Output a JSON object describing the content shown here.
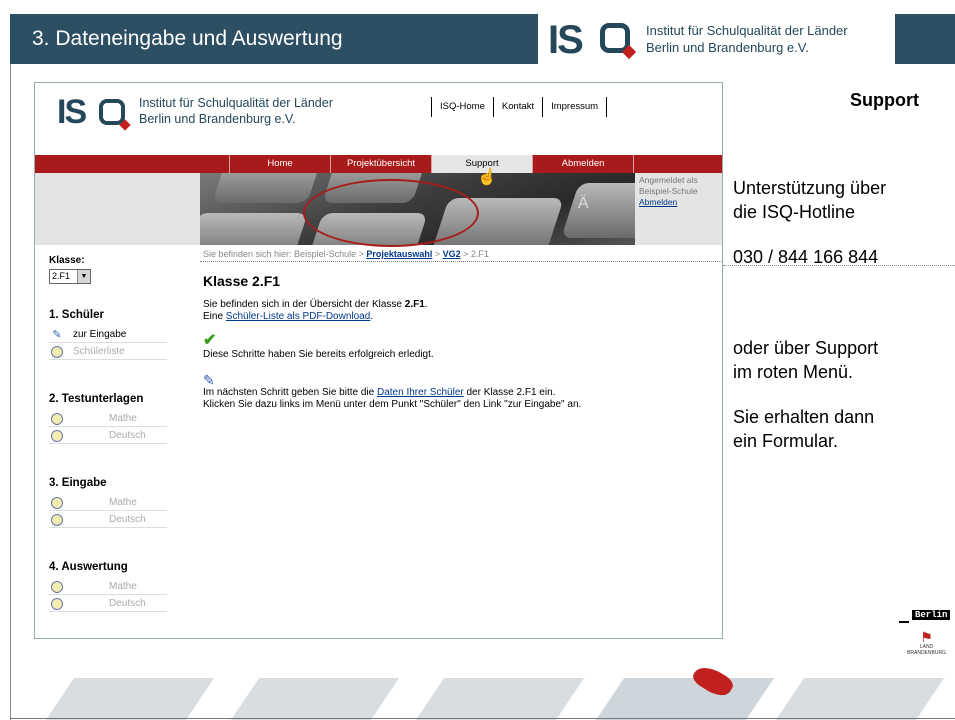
{
  "slide": {
    "title": "3.  Dateneingabe und Auswertung",
    "logo_text_line1": "Institut für Schulqualität der Länder",
    "logo_text_line2": "Berlin und Brandenburg e.V.",
    "logo_letters": "IS"
  },
  "web": {
    "logo_text_line1": "Institut für Schulqualität der Länder",
    "logo_text_line2": "Berlin und Brandenburg e.V.",
    "top_links": [
      "ISQ-Home",
      "Kontakt",
      "Impressum"
    ],
    "nav": [
      "Home",
      "Projektübersicht",
      "Support",
      "Abmelden"
    ],
    "nav_active": "Support",
    "banner_keys": [
      "Ä"
    ],
    "login": {
      "line1": "Angemeldet als",
      "line2": "Beispiel-Schule",
      "logout": "Abmelden"
    },
    "breadcrumb": {
      "prefix": "Sie befinden sich hier: Beispiel-Schule > ",
      "link1": "Projektauswahl",
      "sep": " > ",
      "link2": "VG2",
      "suffix": " > 2.F1"
    },
    "sidebar": {
      "klasse_label": "Klasse:",
      "klasse_value": "2.F1",
      "sections": [
        {
          "title": "1. Schüler",
          "items": [
            "zur Eingabe",
            "Schülerliste"
          ]
        },
        {
          "title": "2. Testunterlagen",
          "items": [
            "Mathe",
            "Deutsch"
          ]
        },
        {
          "title": "3. Eingabe",
          "items": [
            "Mathe",
            "Deutsch"
          ]
        },
        {
          "title": "4. Auswertung",
          "items": [
            "Mathe",
            "Deutsch"
          ]
        }
      ]
    },
    "main": {
      "heading": "Klasse 2.F1",
      "intro_1": "Sie befinden sich in der Übersicht der Klasse ",
      "intro_bold": "2.F1",
      "intro_2": ".",
      "intro_line2_prefix": "Eine ",
      "pdf_link": "Schüler-Liste als PDF-Download",
      "intro_line2_suffix": ".",
      "done_text": "Diese Schritte haben Sie bereits erfolgreich erledigt.",
      "next_1": "Im nächsten Schritt geben Sie bitte die ",
      "next_link": "Daten Ihrer Schüler",
      "next_2": " der Klasse 2.F1 ein.",
      "next_line2": "Klicken Sie dazu links im Menü unter dem Punkt \"Schüler\" den Link \"zur Eingabe\" an."
    }
  },
  "right": {
    "heading": "Support",
    "p1_line1": "Unterstützung über",
    "p1_line2": "die ISQ-Hotline",
    "phone": "030 / 844 166 844",
    "p2_line1": "oder über Support",
    "p2_line2": "im roten Menü.",
    "p3_line1": "Sie erhalten dann",
    "p3_line2": "ein Formular."
  },
  "footer_logos": {
    "berlin": "Berlin",
    "brandenburg_line1": "LAND",
    "brandenburg_line2": "BRANDENBURG"
  },
  "colors": {
    "header_bg": "#2d4f63",
    "nav_red": "#a91a1a",
    "link_blue": "#003a8c",
    "accent_red": "#c0201e"
  }
}
